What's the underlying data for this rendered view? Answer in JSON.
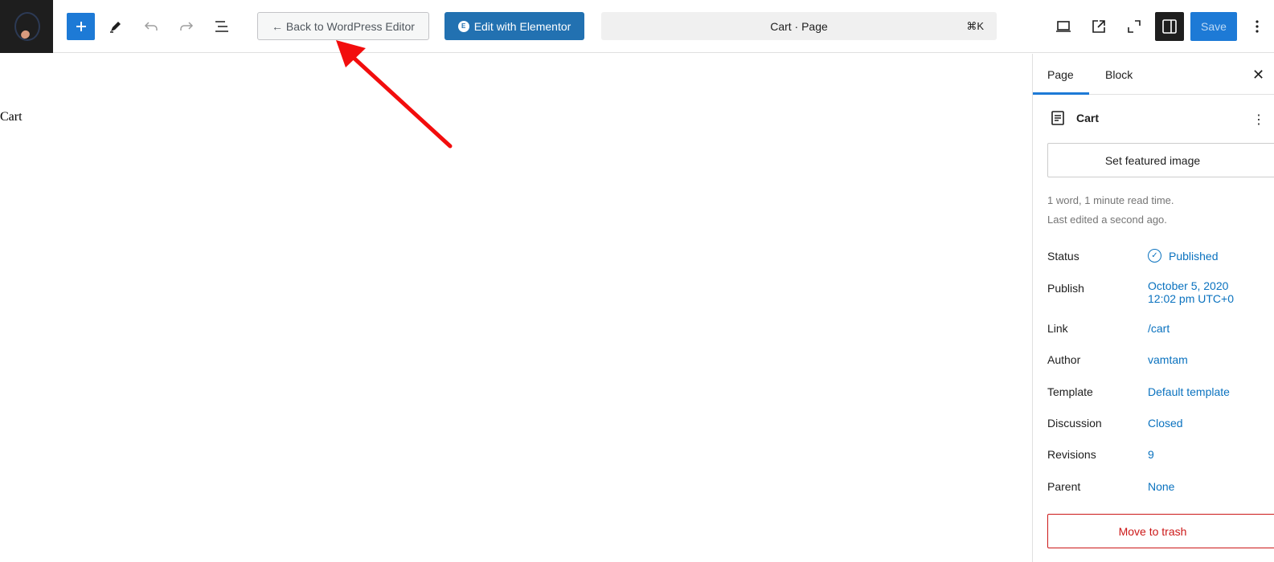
{
  "toolbar": {
    "back_label": "← Back to WordPress Editor",
    "elementor_label": "Edit with Elementor",
    "elementor_badge": "E",
    "command_title": "Cart · Page",
    "command_shortcut": "⌘K",
    "save_label": "Save"
  },
  "canvas": {
    "post_title": "Cart"
  },
  "sidebar": {
    "tabs": [
      "Page",
      "Block"
    ],
    "close": "✕",
    "doc_name": "Cart",
    "doc_more": "⋮",
    "featured_label": "Set featured image",
    "meta_words": "1 word, 1 minute read time.",
    "meta_edited": "Last edited a second ago.",
    "properties": {
      "status": {
        "label": "Status",
        "value": "Published"
      },
      "publish": {
        "label": "Publish",
        "value_line1": "October 5, 2020",
        "value_line2": "12:02 pm UTC+0"
      },
      "link": {
        "label": "Link",
        "value": "/cart"
      },
      "author": {
        "label": "Author",
        "value": "vamtam"
      },
      "template": {
        "label": "Template",
        "value": "Default template"
      },
      "discussion": {
        "label": "Discussion",
        "value": "Closed"
      },
      "revisions": {
        "label": "Revisions",
        "value": "9"
      },
      "parent": {
        "label": "Parent",
        "value": "None"
      }
    },
    "trash_label": "Move to trash"
  },
  "colors": {
    "accent": "#1d7ad6",
    "link": "#0a72bf",
    "danger": "#cc1818",
    "annotation": "#f20d0d"
  },
  "icons": [
    "site-logo",
    "plus-icon",
    "pencil-icon",
    "undo-icon",
    "redo-icon",
    "list-view-icon",
    "desktop-icon",
    "external-link-icon",
    "fullscreen-icon",
    "sidebar-icon",
    "more-vertical-icon",
    "document-icon",
    "check-circle-icon",
    "close-icon"
  ]
}
